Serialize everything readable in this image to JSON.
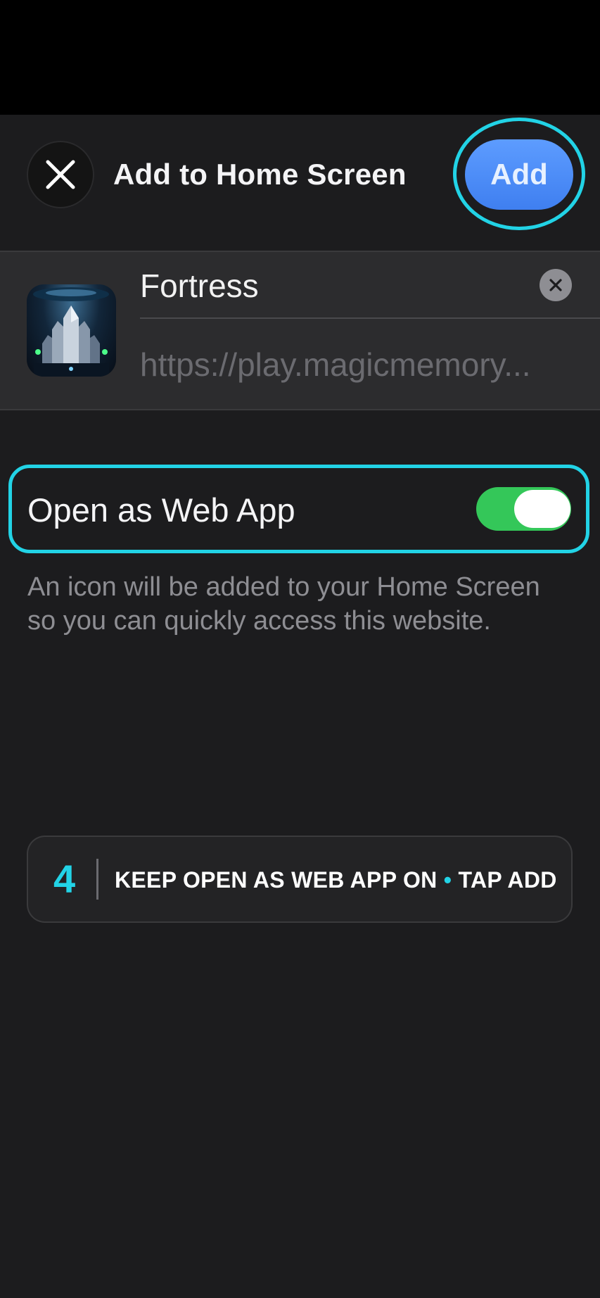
{
  "header": {
    "title": "Add to Home Screen",
    "add_label": "Add",
    "close_icon": "close-icon"
  },
  "bookmark": {
    "name": "Fortress",
    "url": "https://play.magicmemory...",
    "clear_icon": "clear-icon",
    "app_icon": "fortress-app-icon"
  },
  "web_app": {
    "label": "Open as Web App",
    "enabled": true,
    "description": "An icon will be added to your Home Screen so you can quickly access this website."
  },
  "tip": {
    "step": "4",
    "text_part1": "KEEP OPEN AS WEB APP ON",
    "separator": "•",
    "text_part2": "TAP ADD"
  },
  "colors": {
    "accent_highlight": "#22d3e6",
    "add_button": "#4a8cff",
    "toggle_on": "#34c759",
    "background": "#1c1c1e",
    "panel": "#2c2c2e"
  }
}
